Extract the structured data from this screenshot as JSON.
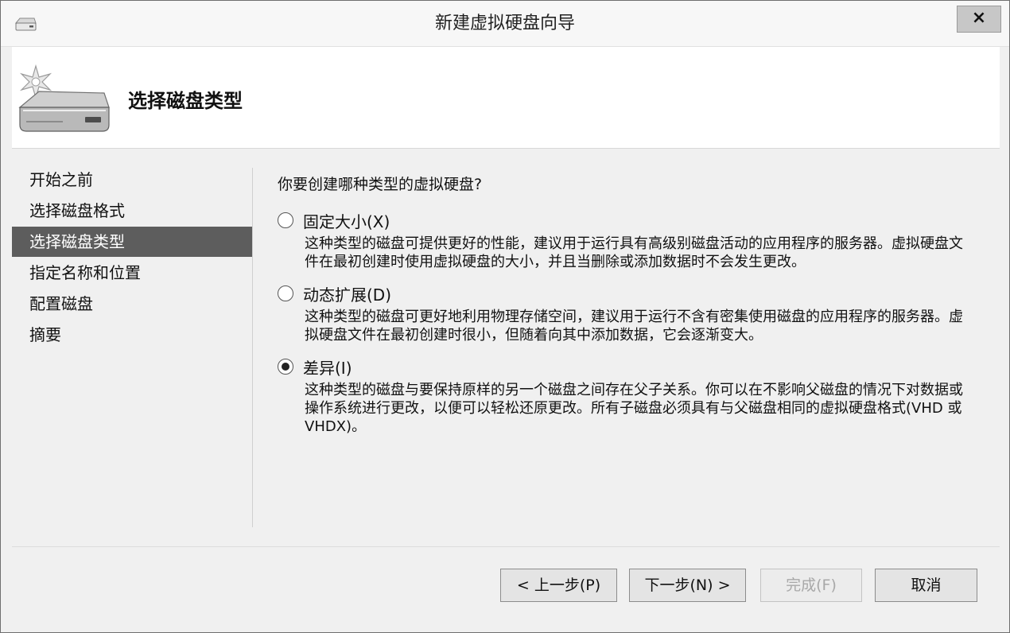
{
  "window": {
    "title": "新建虚拟硬盘向导",
    "close_label": "×"
  },
  "header": {
    "title": "选择磁盘类型"
  },
  "nav": {
    "items": [
      {
        "label": "开始之前",
        "active": false
      },
      {
        "label": "选择磁盘格式",
        "active": false
      },
      {
        "label": "选择磁盘类型",
        "active": true
      },
      {
        "label": "指定名称和位置",
        "active": false
      },
      {
        "label": "配置磁盘",
        "active": false
      },
      {
        "label": "摘要",
        "active": false
      }
    ]
  },
  "content": {
    "question": "你要创建哪种类型的虚拟硬盘?",
    "options": [
      {
        "label": "固定大小(X)",
        "checked": false,
        "description": "这种类型的磁盘可提供更好的性能，建议用于运行具有高级别磁盘活动的应用程序的服务器。虚拟硬盘文件在最初创建时使用虚拟硬盘的大小，并且当删除或添加数据时不会发生更改。"
      },
      {
        "label": "动态扩展(D)",
        "checked": false,
        "description": "这种类型的磁盘可更好地利用物理存储空间，建议用于运行不含有密集使用磁盘的应用程序的服务器。虚拟硬盘文件在最初创建时很小，但随着向其中添加数据，它会逐渐变大。"
      },
      {
        "label": "差异(I)",
        "checked": true,
        "description": "这种类型的磁盘与要保持原样的另一个磁盘之间存在父子关系。你可以在不影响父磁盘的情况下对数据或操作系统进行更改，以便可以轻松还原更改。所有子磁盘必须具有与父磁盘相同的虚拟硬盘格式(VHD 或 VHDX)。"
      }
    ]
  },
  "footer": {
    "prev_label": "< 上一步(P)",
    "next_label": "下一步(N) >",
    "finish_label": "完成(F)",
    "cancel_label": "取消",
    "finish_enabled": false
  },
  "colors": {
    "nav_active_bg": "#5d5d5d",
    "window_bg": "#f0f0f0",
    "header_bg": "#ffffff"
  }
}
